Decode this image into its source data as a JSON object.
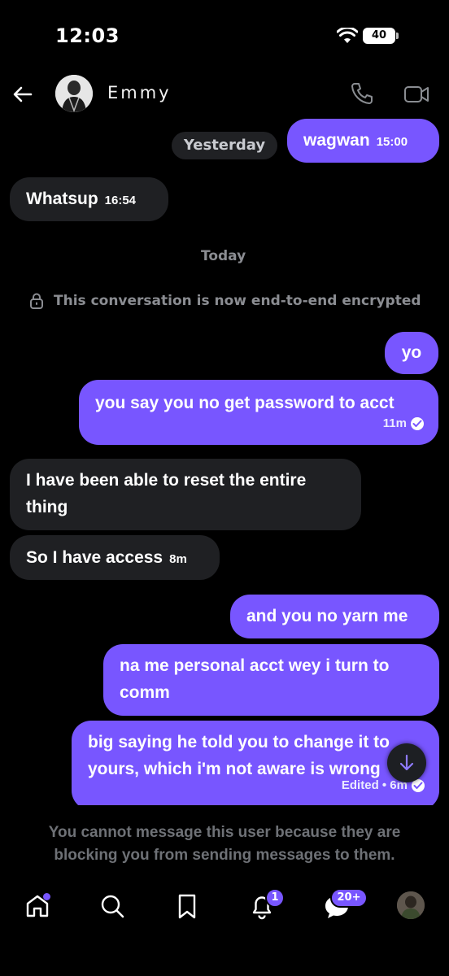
{
  "status_bar": {
    "time": "12:03",
    "battery": "40"
  },
  "header": {
    "contact_name": "Emmy"
  },
  "chat": {
    "dividers": {
      "yesterday": "Yesterday",
      "today": "Today"
    },
    "encryption_notice": "This conversation is now end-to-end encrypted",
    "messages": [
      {
        "direction": "out",
        "text": "wagwan",
        "time": "15:00"
      },
      {
        "direction": "in",
        "text": "Whatsup",
        "time": "16:54"
      },
      {
        "direction": "out",
        "text": "yo"
      },
      {
        "direction": "out",
        "text": "you say you no get password to acct",
        "time": "11m"
      },
      {
        "direction": "in",
        "text": "I have been able to reset the entire thing"
      },
      {
        "direction": "in",
        "text": "So I have access",
        "time": "8m"
      },
      {
        "direction": "out",
        "text": "and you no yarn me"
      },
      {
        "direction": "out",
        "text": "na me personal acct wey i turn to comm"
      },
      {
        "direction": "out",
        "text": "big saying he told you to change it to yours, which i'm not aware is wrong",
        "time": "Edited • 6m"
      }
    ]
  },
  "blocked_notice": "You cannot message this user because they are blocking you from sending messages to them.",
  "bottom_nav": {
    "notifications_badge": "1",
    "messages_badge": "20+"
  },
  "colors": {
    "accent": "#7856ff",
    "incoming_bubble": "#1f2023",
    "background": "#000000"
  }
}
